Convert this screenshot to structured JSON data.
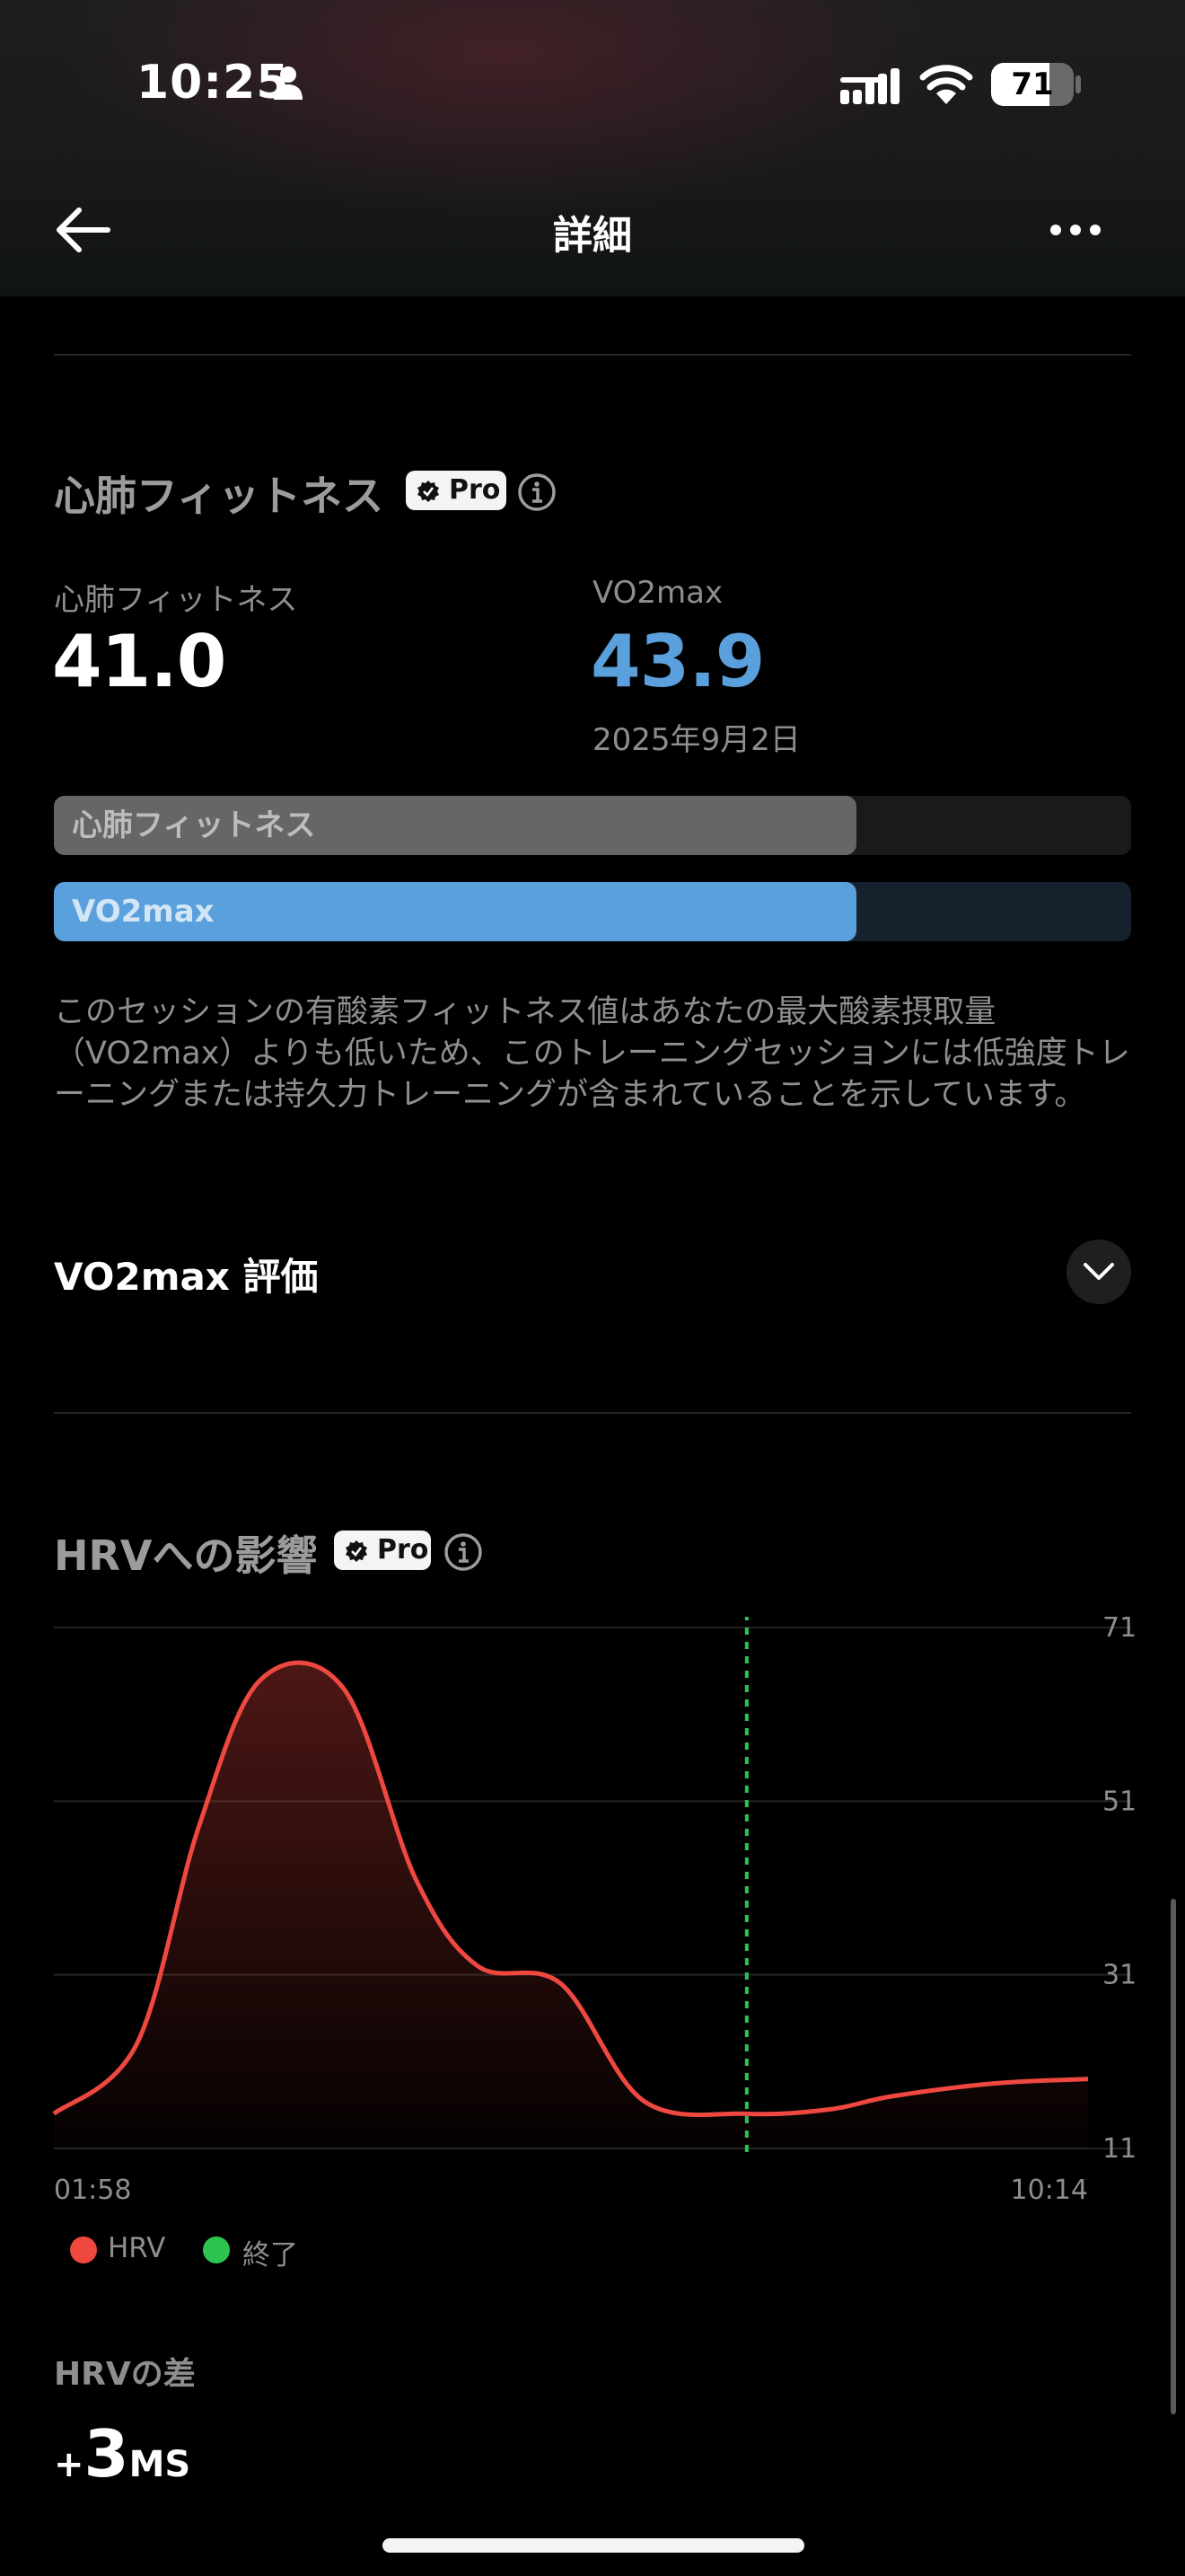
{
  "status_bar": {
    "time": "10:25",
    "battery": "71",
    "battery_level": 0.71
  },
  "nav": {
    "title": "詳細"
  },
  "cardio": {
    "title": "心肺フィットネス",
    "badge": "Pro",
    "fitness_label": "心肺フィットネス",
    "fitness_value": "41.0",
    "vo2_label": "VO2max",
    "vo2_value": "43.9",
    "vo2_date": "2025年9月2日",
    "bar_fitness_label": "心肺フィットネス",
    "bar_fitness_level": 0.745,
    "bar_vo2_label": "VO2max",
    "bar_vo2_level": 0.745,
    "description": "このセッションの有酸素フィットネス値はあなたの最大酸素摂取量（VO2max）よりも低いため、このトレーニングセッションには低強度トレーニングまたは持久力トレーニングが含まれていることを示しています。",
    "vo2_eval_label": "VO2max 評価"
  },
  "hrv": {
    "title": "HRVへの影響",
    "badge": "Pro",
    "diff_label": "HRVの差",
    "diff_sign": "+",
    "diff_value": "3",
    "diff_unit": "MS"
  },
  "chart_data": {
    "type": "area",
    "x_start_label": "01:58",
    "x_end_label": "10:14",
    "y_ticks": [
      "11",
      "31",
      "51",
      "71"
    ],
    "ylim": [
      11,
      71
    ],
    "x": [
      0,
      0.08,
      0.14,
      0.2,
      0.28,
      0.35,
      0.41,
      0.49,
      0.57,
      0.67,
      0.75,
      0.81,
      0.91,
      1.0
    ],
    "series": [
      {
        "name": "HRV",
        "color": "#ef4840",
        "values": [
          15,
          23,
          48,
          65,
          64,
          42,
          32,
          30,
          16.5,
          15,
          15.5,
          17,
          18.5,
          19
        ]
      }
    ],
    "end_marker_x": 0.67,
    "legend": [
      {
        "label": "HRV",
        "color": "#ef4840"
      },
      {
        "label": "終了",
        "color": "#2ec450"
      }
    ],
    "grid": true
  },
  "colors": {
    "accent_blue": "#5aa0dc",
    "hrv_red": "#ef4840",
    "end_green": "#2ec450"
  }
}
